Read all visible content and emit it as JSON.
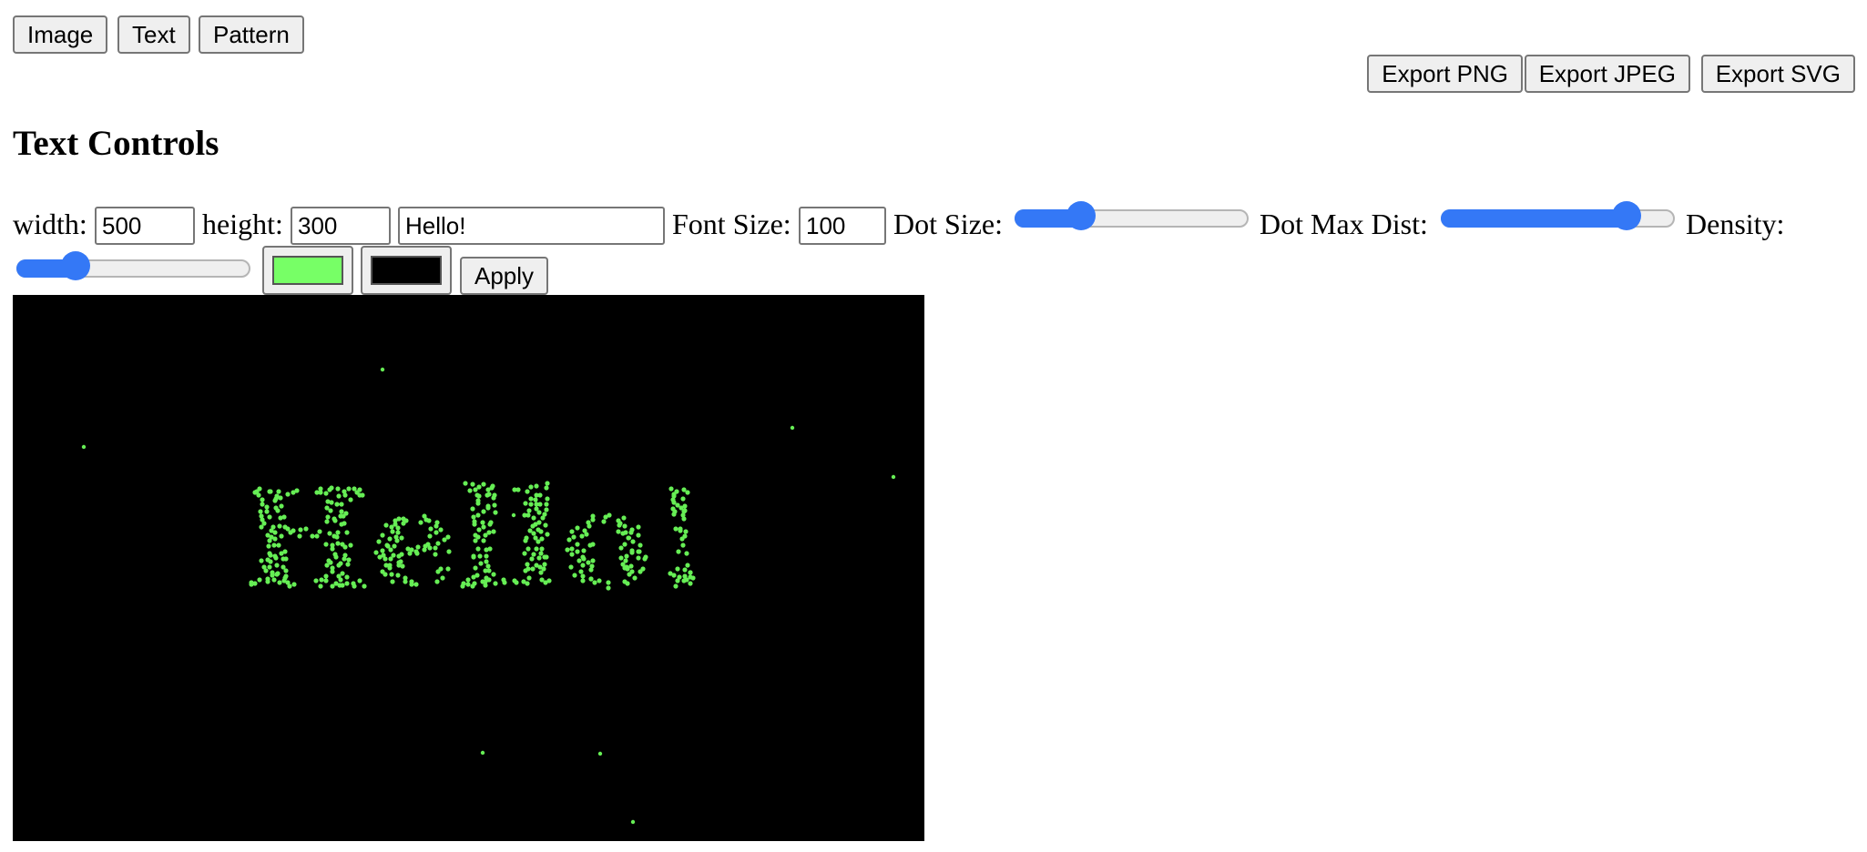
{
  "tabs": [
    {
      "label": "Image"
    },
    {
      "label": "Text"
    },
    {
      "label": "Pattern"
    }
  ],
  "export": {
    "png_label": "Export PNG",
    "jpeg_label": "Export JPEG",
    "svg_label": "Export SVG"
  },
  "section_title": "Text Controls",
  "controls": {
    "width_label": "width:",
    "width_value": "500",
    "height_label": "height:",
    "height_value": "300",
    "text_value": "Hello!",
    "font_size_label": "Font Size:",
    "font_size_value": "100",
    "dot_size_label": "Dot Size:",
    "dot_size_level": 0.28,
    "dot_max_dist_label": "Dot Max Dist:",
    "dot_max_dist_level": 0.8,
    "density_label": "Density:",
    "density_level": 0.25,
    "dot_color": "#77ff66",
    "background_color": "#000000",
    "apply_label": "Apply"
  },
  "canvas": {
    "text": "Hello!",
    "background": "#000000",
    "dot_color": "#66ee55"
  }
}
